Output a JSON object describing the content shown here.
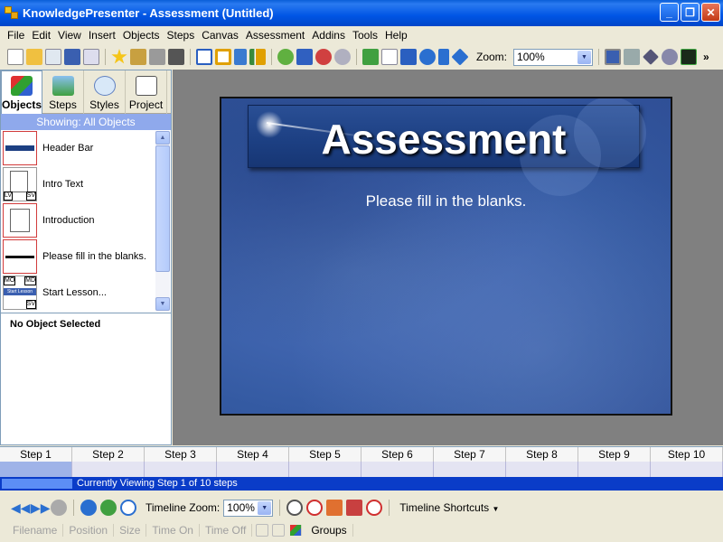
{
  "window": {
    "title": "KnowledgePresenter - Assessment (Untitled)",
    "controls": [
      "minimize",
      "restore",
      "close"
    ]
  },
  "menu": [
    "File",
    "Edit",
    "View",
    "Insert",
    "Objects",
    "Steps",
    "Canvas",
    "Assessment",
    "Addins",
    "Tools",
    "Help"
  ],
  "toolbar": {
    "zoom_label": "Zoom:",
    "zoom_value": "100%",
    "overflow": "»"
  },
  "left_panel": {
    "tabs": [
      {
        "label": "Objects",
        "icon": "objects-icon"
      },
      {
        "label": "Steps",
        "icon": "steps-icon"
      },
      {
        "label": "Styles",
        "icon": "styles-icon"
      },
      {
        "label": "Project",
        "icon": "project-icon"
      }
    ],
    "showing": "Showing: All Objects",
    "objects": [
      {
        "label": "Header Bar",
        "thumb": "header-bar-thumb"
      },
      {
        "label": "Intro Text",
        "thumb": "document-thumb",
        "badges": [
          "LV",
          "SV"
        ]
      },
      {
        "label": "Introduction",
        "thumb": "document-thumb"
      },
      {
        "label": "Please fill in the blanks.",
        "thumb": "text-line-thumb"
      },
      {
        "label": "Start Lesson...",
        "thumb": "button-thumb",
        "badges": [
          "MO",
          "MD",
          "Start Lesson",
          "SV"
        ]
      }
    ],
    "selection": "No Object Selected"
  },
  "canvas": {
    "title": "Assessment",
    "subtitle": "Please fill in the blanks."
  },
  "timeline": {
    "steps": [
      "Step 1",
      "Step 2",
      "Step 3",
      "Step 4",
      "Step 5",
      "Step 6",
      "Step 7",
      "Step 8",
      "Step 9",
      "Step 10"
    ],
    "status": "Currently Viewing Step 1 of 10 steps",
    "zoom_label": "Timeline Zoom:",
    "zoom_value": "100%",
    "shortcuts": "Timeline Shortcuts"
  },
  "properties": {
    "fields": [
      "Filename",
      "Position",
      "Size",
      "Time On",
      "Time Off"
    ],
    "groups": "Groups"
  },
  "colors": {
    "titlebar": "#0055e5",
    "showing_header": "#8fa9ec",
    "status_bar": "#0a3cc8",
    "canvas_bg": "#808080",
    "slide_bg": "#3e63ad"
  }
}
